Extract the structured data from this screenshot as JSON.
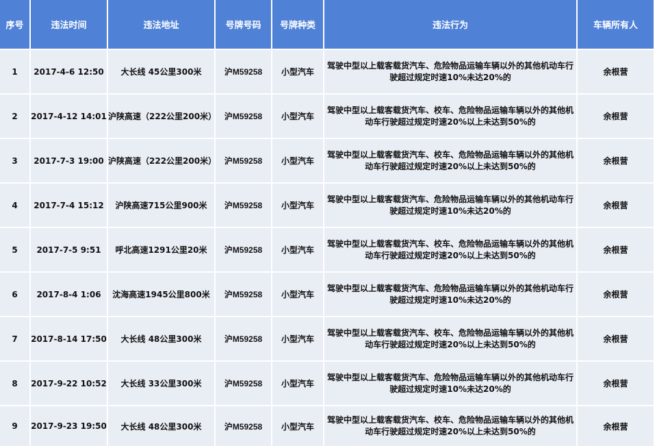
{
  "table": {
    "headers": [
      "序号",
      "违法时间",
      "违法地址",
      "号牌号码",
      "号牌种类",
      "违法行为",
      "车辆所有人"
    ],
    "rows": [
      {
        "no": "1",
        "time": "2017-4-6 12:50",
        "address": "大长线 45公里300米",
        "plate": "沪M59258",
        "plate_type": "小型汽车",
        "act": "驾驶中型以上载客载货汽车、危险物品运输车辆以外的其他机动车行驶超过规定时速10%未达20%的",
        "owner": "余根营"
      },
      {
        "no": "2",
        "time": "2017-4-12 14:01",
        "address": "沪陕高速（222公里200米）",
        "plate": "沪M59258",
        "plate_type": "小型汽车",
        "act": "驾驶中型以上载客载货汽车、校车、危险物品运输车辆以外的其他机动车行驶超过规定时速20%以上未达到50%的",
        "owner": "余根营"
      },
      {
        "no": "3",
        "time": "2017-7-3 19:00",
        "address": "沪陕高速（222公里200米）",
        "plate": "沪M59258",
        "plate_type": "小型汽车",
        "act": "驾驶中型以上载客载货汽车、校车、危险物品运输车辆以外的其他机动车行驶超过规定时速20%以上未达到50%的",
        "owner": "余根营"
      },
      {
        "no": "4",
        "time": "2017-7-4 15:12",
        "address": "沪陕高速715公里900米",
        "plate": "沪M59258",
        "plate_type": "小型汽车",
        "act": "驾驶中型以上载客载货汽车、危险物品运输车辆以外的其他机动车行驶超过规定时速10%未达20%的",
        "owner": "余根营"
      },
      {
        "no": "5",
        "time": "2017-7-5 9:51",
        "address": "呼北高速1291公里20米",
        "plate": "沪M59258",
        "plate_type": "小型汽车",
        "act": "驾驶中型以上载客载货汽车、校车、危险物品运输车辆以外的其他机动车行驶超过规定时速20%以上未达到50%的",
        "owner": "余根营"
      },
      {
        "no": "6",
        "time": "2017-8-4 1:06",
        "address": "沈海高速1945公里800米",
        "plate": "沪M59258",
        "plate_type": "小型汽车",
        "act": "驾驶中型以上载客载货汽车、危险物品运输车辆以外的其他机动车行驶超过规定时速10%未达20%的",
        "owner": "余根营"
      },
      {
        "no": "7",
        "time": "2017-8-14 17:50",
        "address": "大长线 48公里300米",
        "plate": "沪M59258",
        "plate_type": "小型汽车",
        "act": "驾驶中型以上载客载货汽车、校车、危险物品运输车辆以外的其他机动车行驶超过规定时速20%以上未达到50%的",
        "owner": "余根营"
      },
      {
        "no": "8",
        "time": "2017-9-22 10:52",
        "address": "大长线 33公里300米",
        "plate": "沪M59258",
        "plate_type": "小型汽车",
        "act": "驾驶中型以上载客载货汽车、危险物品运输车辆以外的其他机动车行驶超过规定时速10%未达20%的",
        "owner": "余根营"
      },
      {
        "no": "9",
        "time": "2017-9-23 19:50",
        "address": "大长线 48公里300米",
        "plate": "沪M59258",
        "plate_type": "小型汽车",
        "act": "驾驶中型以上载客载货汽车、校车、危险物品运输车辆以外的其他机动车行驶超过规定时速20%以上未达到50%的",
        "owner": "余根营"
      }
    ]
  },
  "colors": {
    "header_bg": "#4f81d6",
    "header_text": "#ffffff",
    "row_bg": "#e9edf4"
  }
}
